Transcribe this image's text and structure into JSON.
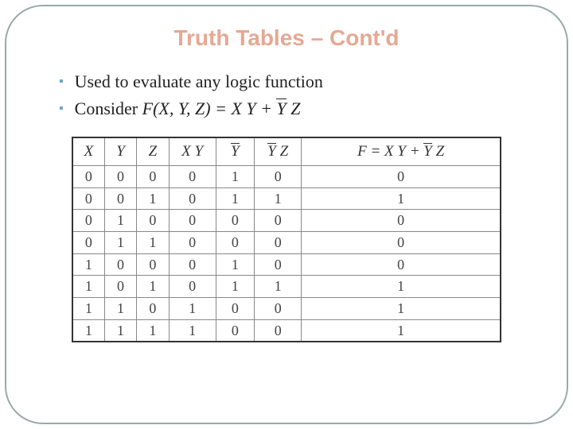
{
  "title": "Truth Tables – Cont'd",
  "bullets": {
    "b1": "Used to evaluate any logic function",
    "b2_prefix": "Consider ",
    "b2_func": "F(X, Y, Z) = X Y + ",
    "b2_ybar": "Y",
    "b2_tail": " Z"
  },
  "headers": {
    "x": "X",
    "y": "Y",
    "z": "Z",
    "xy": "X Y",
    "yb": "Y",
    "ybz_y": "Y",
    "ybz_z": " Z",
    "f_pre": "F = X Y + ",
    "f_y": "Y",
    "f_z": " Z"
  },
  "rows": [
    {
      "x": "0",
      "y": "0",
      "z": "0",
      "xy": "0",
      "yb": "1",
      "ybz": "0",
      "f": "0"
    },
    {
      "x": "0",
      "y": "0",
      "z": "1",
      "xy": "0",
      "yb": "1",
      "ybz": "1",
      "f": "1"
    },
    {
      "x": "0",
      "y": "1",
      "z": "0",
      "xy": "0",
      "yb": "0",
      "ybz": "0",
      "f": "0"
    },
    {
      "x": "0",
      "y": "1",
      "z": "1",
      "xy": "0",
      "yb": "0",
      "ybz": "0",
      "f": "0"
    },
    {
      "x": "1",
      "y": "0",
      "z": "0",
      "xy": "0",
      "yb": "1",
      "ybz": "0",
      "f": "0"
    },
    {
      "x": "1",
      "y": "0",
      "z": "1",
      "xy": "0",
      "yb": "1",
      "ybz": "1",
      "f": "1"
    },
    {
      "x": "1",
      "y": "1",
      "z": "0",
      "xy": "1",
      "yb": "0",
      "ybz": "0",
      "f": "1"
    },
    {
      "x": "1",
      "y": "1",
      "z": "1",
      "xy": "1",
      "yb": "0",
      "ybz": "0",
      "f": "1"
    }
  ],
  "chart_data": {
    "type": "table",
    "title": "Truth Table for F = X Y + Y' Z",
    "columns": [
      "X",
      "Y",
      "Z",
      "X Y",
      "Y'",
      "Y' Z",
      "F = X Y + Y' Z"
    ],
    "rows": [
      [
        0,
        0,
        0,
        0,
        1,
        0,
        0
      ],
      [
        0,
        0,
        1,
        0,
        1,
        1,
        1
      ],
      [
        0,
        1,
        0,
        0,
        0,
        0,
        0
      ],
      [
        0,
        1,
        1,
        0,
        0,
        0,
        0
      ],
      [
        1,
        0,
        0,
        0,
        1,
        0,
        0
      ],
      [
        1,
        0,
        1,
        0,
        1,
        1,
        1
      ],
      [
        1,
        1,
        0,
        1,
        0,
        0,
        1
      ],
      [
        1,
        1,
        1,
        1,
        0,
        0,
        1
      ]
    ]
  }
}
